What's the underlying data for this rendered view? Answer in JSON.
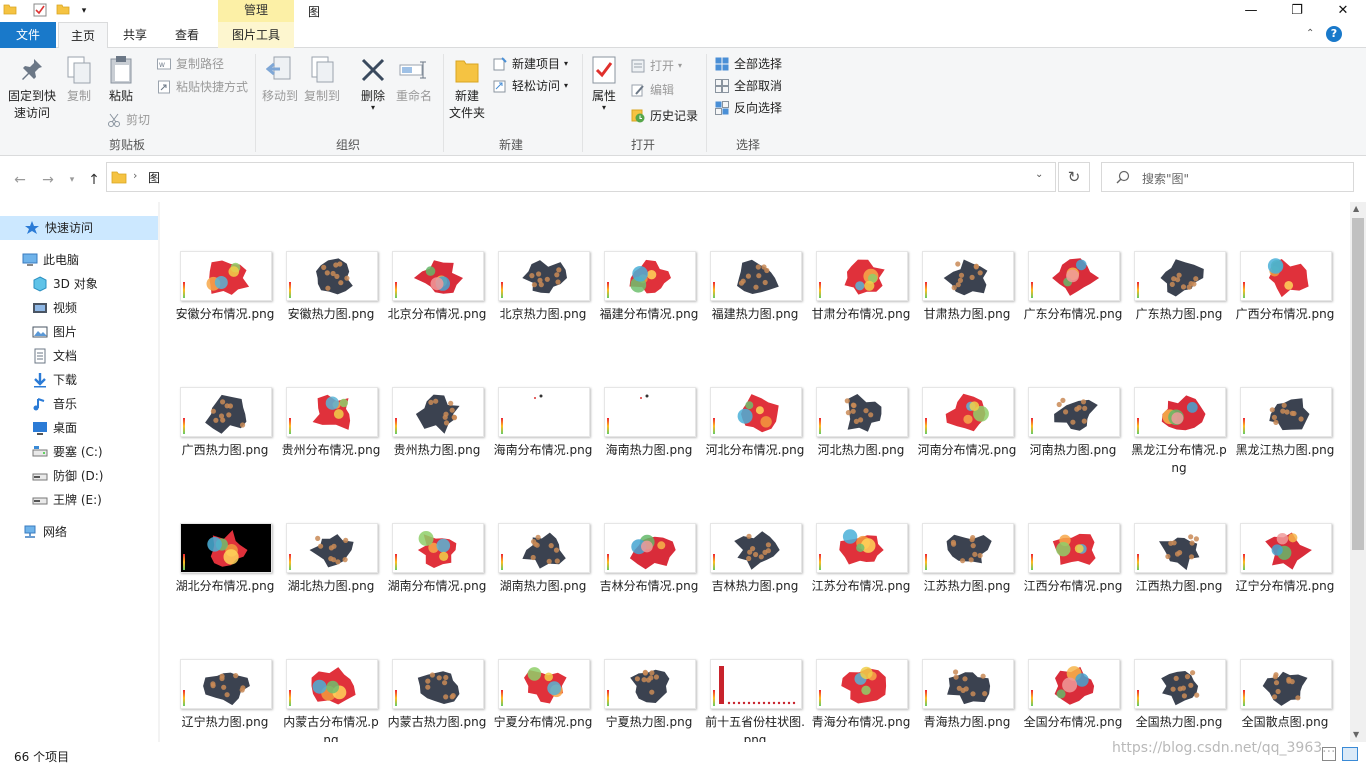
{
  "window": {
    "title": "图",
    "context_tab": "管理",
    "minimize": "—",
    "maximize": "❐",
    "close": "✕"
  },
  "tabs": [
    {
      "label": "文件"
    },
    {
      "label": "主页"
    },
    {
      "label": "共享"
    },
    {
      "label": "查看"
    },
    {
      "label": "图片工具"
    }
  ],
  "ribbon": {
    "clipboard": {
      "pin_line1": "固定到快",
      "pin_line2": "速访问",
      "copy": "复制",
      "paste": "粘贴",
      "copy_path": "复制路径",
      "paste_shortcut": "粘贴快捷方式",
      "cut": "剪切",
      "label": "剪贴板"
    },
    "organize": {
      "move_to": "移动到",
      "copy_to": "复制到",
      "delete": "删除",
      "rename": "重命名",
      "label": "组织"
    },
    "new": {
      "new_folder_line1": "新建",
      "new_folder_line2": "文件夹",
      "new_item": "新建项目",
      "easy_access": "轻松访问",
      "label": "新建"
    },
    "open": {
      "properties": "属性",
      "open": "打开",
      "edit": "编辑",
      "history": "历史记录",
      "label": "打开"
    },
    "select": {
      "select_all": "全部选择",
      "select_none": "全部取消",
      "invert": "反向选择",
      "label": "选择"
    }
  },
  "address": {
    "path": "图",
    "search_placeholder": "搜索\"图\""
  },
  "sidebar": [
    {
      "label": "快速访问",
      "icon": "star-icon"
    },
    {
      "label": "此电脑",
      "icon": "computer-icon"
    },
    {
      "label": "3D 对象",
      "icon": "3d-objects-icon"
    },
    {
      "label": "视频",
      "icon": "video-icon"
    },
    {
      "label": "图片",
      "icon": "pictures-icon"
    },
    {
      "label": "文档",
      "icon": "documents-icon"
    },
    {
      "label": "下载",
      "icon": "download-icon"
    },
    {
      "label": "音乐",
      "icon": "music-icon"
    },
    {
      "label": "桌面",
      "icon": "desktop-icon"
    },
    {
      "label": "要塞 (C:)",
      "icon": "drive-c-icon"
    },
    {
      "label": "防御 (D:)",
      "icon": "drive-icon"
    },
    {
      "label": "王牌 (E:)",
      "icon": "drive-icon"
    },
    {
      "label": "网络",
      "icon": "network-icon"
    }
  ],
  "files": [
    {
      "name": "安徽分布情况.png",
      "kind": "dist"
    },
    {
      "name": "安徽热力图.png",
      "kind": "heat"
    },
    {
      "name": "北京分布情况.png",
      "kind": "dist"
    },
    {
      "name": "北京热力图.png",
      "kind": "heat"
    },
    {
      "name": "福建分布情况.png",
      "kind": "dist"
    },
    {
      "name": "福建热力图.png",
      "kind": "heat"
    },
    {
      "name": "甘肃分布情况.png",
      "kind": "dist"
    },
    {
      "name": "甘肃热力图.png",
      "kind": "heat"
    },
    {
      "name": "广东分布情况.png",
      "kind": "dist"
    },
    {
      "name": "广东热力图.png",
      "kind": "heat"
    },
    {
      "name": "广西分布情况.png",
      "kind": "dist"
    },
    {
      "name": "广西热力图.png",
      "kind": "heat"
    },
    {
      "name": "贵州分布情况.png",
      "kind": "dist"
    },
    {
      "name": "贵州热力图.png",
      "kind": "heat"
    },
    {
      "name": "海南分布情况.png",
      "kind": "empty"
    },
    {
      "name": "海南热力图.png",
      "kind": "empty"
    },
    {
      "name": "河北分布情况.png",
      "kind": "dist"
    },
    {
      "name": "河北热力图.png",
      "kind": "heat"
    },
    {
      "name": "河南分布情况.png",
      "kind": "dist"
    },
    {
      "name": "河南热力图.png",
      "kind": "heat"
    },
    {
      "name": "黑龙江分布情况.png",
      "kind": "dist"
    },
    {
      "name": "黑龙江热力图.png",
      "kind": "heat"
    },
    {
      "name": "湖北分布情况.png",
      "kind": "black"
    },
    {
      "name": "湖北热力图.png",
      "kind": "heat"
    },
    {
      "name": "湖南分布情况.png",
      "kind": "dist"
    },
    {
      "name": "湖南热力图.png",
      "kind": "heat"
    },
    {
      "name": "吉林分布情况.png",
      "kind": "dist"
    },
    {
      "name": "吉林热力图.png",
      "kind": "heat"
    },
    {
      "name": "江苏分布情况.png",
      "kind": "dist"
    },
    {
      "name": "江苏热力图.png",
      "kind": "heat"
    },
    {
      "name": "江西分布情况.png",
      "kind": "dist"
    },
    {
      "name": "江西热力图.png",
      "kind": "heat"
    },
    {
      "name": "辽宁分布情况.png",
      "kind": "dist"
    },
    {
      "name": "辽宁热力图.png",
      "kind": "heat"
    },
    {
      "name": "内蒙古分布情况.png",
      "kind": "dist"
    },
    {
      "name": "内蒙古热力图.png",
      "kind": "heat"
    },
    {
      "name": "宁夏分布情况.png",
      "kind": "dist"
    },
    {
      "name": "宁夏热力图.png",
      "kind": "heat"
    },
    {
      "name": "前十五省份柱状图.png",
      "kind": "bar"
    },
    {
      "name": "青海分布情况.png",
      "kind": "dist"
    },
    {
      "name": "青海热力图.png",
      "kind": "heat"
    },
    {
      "name": "全国分布情况.png",
      "kind": "dist"
    },
    {
      "name": "全国热力图.png",
      "kind": "heat"
    },
    {
      "name": "全国散点图.png",
      "kind": "heat"
    }
  ],
  "status": {
    "count": "66 个项目"
  },
  "watermark": "https://blog.csdn.net/qq_3963..."
}
